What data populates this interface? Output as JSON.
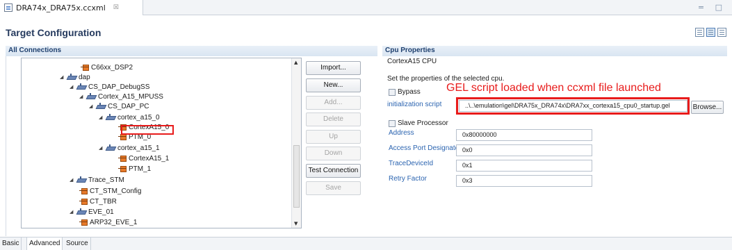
{
  "editor_tab": {
    "title": "DRA74x_DRA75x.ccxml",
    "close": "☒"
  },
  "window_controls": "= □",
  "page_title": "Target Configuration",
  "connections": {
    "header": "All Connections",
    "tree": [
      {
        "label": "C66xx_DSP2",
        "icon": "cpu-icon",
        "twisty": ""
      },
      {
        "label": "dap",
        "icon": "router-icon",
        "twisty": "◢"
      },
      {
        "label": "CS_DAP_DebugSS",
        "icon": "router-icon",
        "twisty": "◢"
      },
      {
        "label": "Cortex_A15_MPUSS",
        "icon": "router-icon",
        "twisty": "◢"
      },
      {
        "label": "CS_DAP_PC",
        "icon": "router-icon",
        "twisty": "◢"
      },
      {
        "label": "cortex_a15_0",
        "icon": "router-icon",
        "twisty": "◢"
      },
      {
        "label": "CortexA15_0",
        "icon": "cpu-icon",
        "twisty": ""
      },
      {
        "label": "PTM_0",
        "icon": "cpu-icon",
        "twisty": ""
      },
      {
        "label": "cortex_a15_1",
        "icon": "router-icon",
        "twisty": "◢"
      },
      {
        "label": "CortexA15_1",
        "icon": "cpu-icon",
        "twisty": ""
      },
      {
        "label": "PTM_1",
        "icon": "cpu-icon",
        "twisty": ""
      },
      {
        "label": "Trace_STM",
        "icon": "router-icon",
        "twisty": "◢"
      },
      {
        "label": "CT_STM_Config",
        "icon": "cpu-icon",
        "twisty": ""
      },
      {
        "label": "CT_TBR",
        "icon": "cpu-icon",
        "twisty": ""
      },
      {
        "label": "EVE_01",
        "icon": "router-icon",
        "twisty": "◢"
      },
      {
        "label": "ARP32_EVE_1",
        "icon": "cpu-icon",
        "twisty": ""
      }
    ],
    "buttons": {
      "import": "Import...",
      "new": "New...",
      "add": "Add...",
      "delete": "Delete",
      "up": "Up",
      "down": "Down",
      "test_connection": "Test Connection",
      "save": "Save"
    }
  },
  "cpu_properties": {
    "header": "Cpu Properties",
    "cpu_name": "CortexA15 CPU",
    "description": "Set the properties of the selected cpu.",
    "bypass_label": "Bypass",
    "annotation": "GEL script loaded when ccxml file launched",
    "init_script_label": "initialization script",
    "init_script_value": "..\\..\\emulation\\gel\\DRA75x_DRA74x\\DRA7xx_cortexa15_cpu0_startup.gel",
    "browse_label": "Browse...",
    "slave_label": "Slave Processor",
    "address_label": "Address",
    "address_value": "0x80000000",
    "apd_label": "Access Port Designator",
    "apd_value": "0x0",
    "trace_label": "TraceDeviceId",
    "trace_value": "0x1",
    "retry_label": "Retry Factor",
    "retry_value": "0x3"
  },
  "bottom_tabs": [
    "Basic",
    "Advanced",
    "Source"
  ],
  "colors": {
    "accent_red": "#e81b1b",
    "header_blue": "#1d3f6e",
    "link_blue": "#2b64b0"
  }
}
